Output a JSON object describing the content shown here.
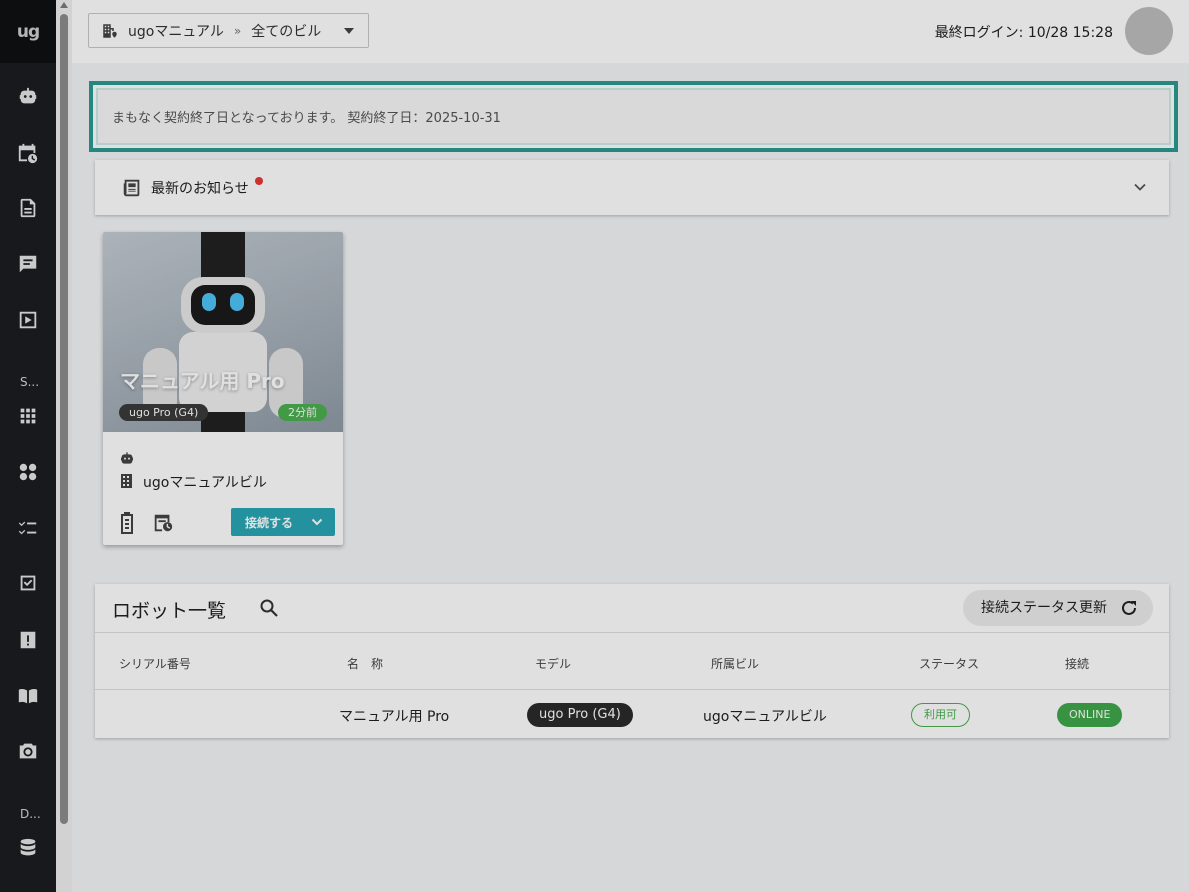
{
  "app": {
    "logo": "ug"
  },
  "sidebar": {
    "section_s": "S...",
    "section_d": "D..."
  },
  "header": {
    "org": "ugoマニュアル",
    "separator": "»",
    "building": "全てのビル",
    "last_login": "最終ログイン: 10/28 15:28"
  },
  "banner": {
    "text": "まもなく契約終了日となっております。 契約終了日：2025-10-31"
  },
  "news": {
    "title": "最新のお知らせ"
  },
  "robot_card": {
    "name": "マニュアル用 Pro",
    "model": "ugo Pro (G4)",
    "last_seen": "2分前",
    "building": "ugoマニュアルビル",
    "connect_label": "接続する"
  },
  "robot_list": {
    "title": "ロボット一覧",
    "refresh_label": "接続ステータス更新",
    "columns": [
      "シリアル番号",
      "名　称",
      "モデル",
      "所属ビル",
      "ステータス",
      "接続"
    ],
    "rows": [
      {
        "serial": "",
        "name": "マニュアル用 Pro",
        "model": "ugo Pro (G4)",
        "building": "ugoマニュアルビル",
        "status": "利用可",
        "connection": "ONLINE"
      }
    ]
  },
  "colors": {
    "accent": "#2aa7b4",
    "banner_border": "#2a9b92",
    "online": "#3fa84a",
    "sidebar": "#1b1d20"
  }
}
